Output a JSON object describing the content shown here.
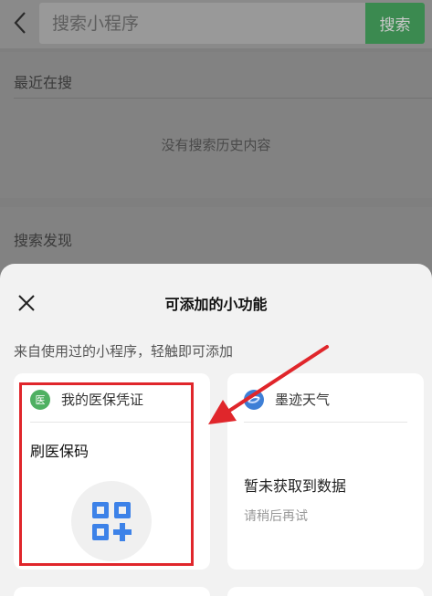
{
  "search_bar": {
    "placeholder": "搜索小程序",
    "button_label": "搜索"
  },
  "recent": {
    "title": "最近在搜",
    "empty_text": "没有搜索历史内容"
  },
  "discover": {
    "title": "搜索发现"
  },
  "sheet": {
    "title": "可添加的小功能",
    "subtitle": "来自使用过的小程序，轻触即可添加",
    "cards": [
      {
        "app_name": "我的医保凭证",
        "app_icon_text": "医",
        "function_title": "刷医保码",
        "icon": "qr-code-add-icon"
      },
      {
        "app_name": "墨迹天气",
        "icon": "weather-app-icon",
        "empty_main": "暂未获取到数据",
        "empty_sub": "请稍后再试"
      }
    ]
  },
  "colors": {
    "accent_green": "#07c160",
    "annotation_red": "#e0262b",
    "qr_blue": "#3d82e8"
  }
}
